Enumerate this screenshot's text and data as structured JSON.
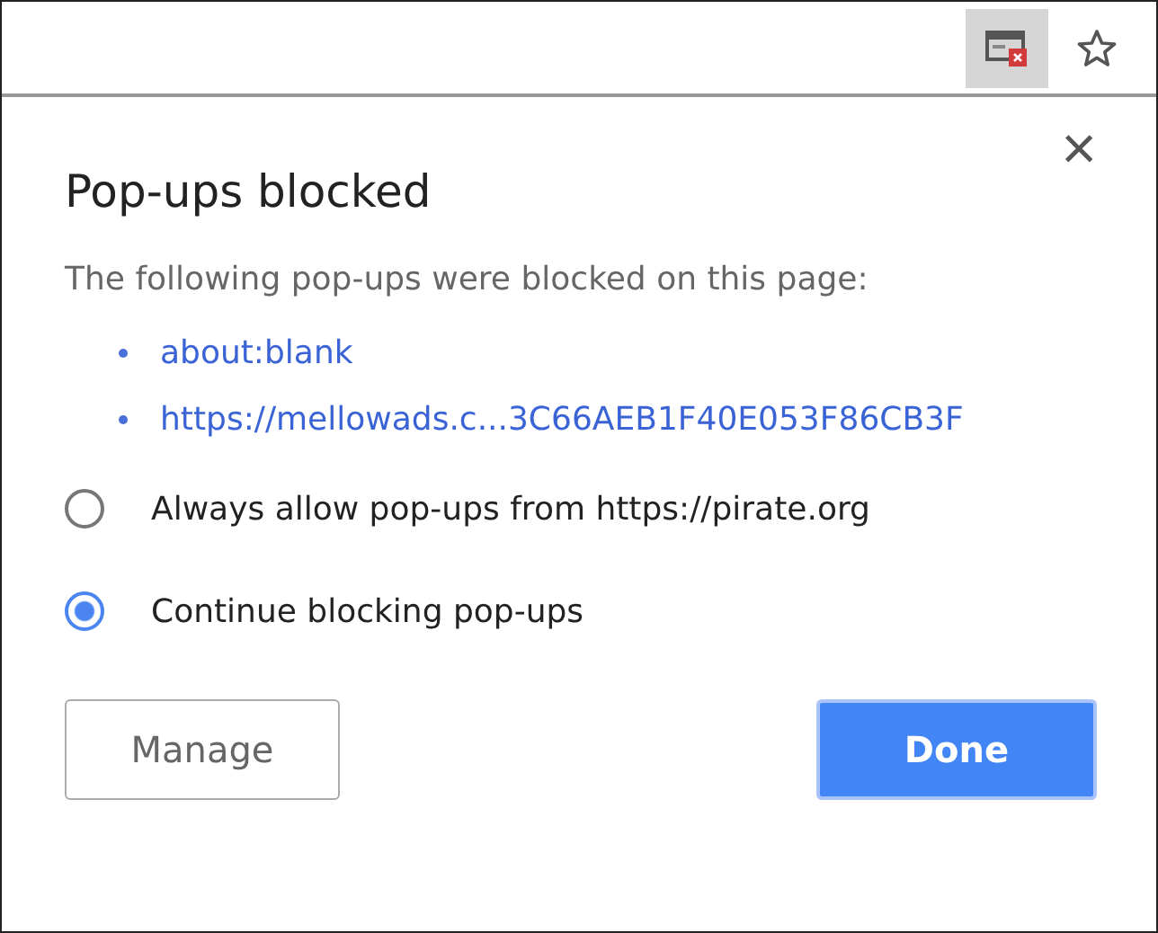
{
  "toolbar": {
    "popup_blocked_pressed": true
  },
  "dialog": {
    "title": "Pop-ups blocked",
    "close": "×",
    "description": "The following pop-ups were blocked on this page:",
    "links": [
      "about:blank",
      "https://mellowads.c...3C66AEB1F40E053F86CB3F"
    ],
    "options": [
      {
        "label": "Always allow pop-ups from https://pirate.org",
        "selected": false
      },
      {
        "label": "Continue blocking pop-ups",
        "selected": true
      }
    ],
    "buttons": [
      {
        "label": "Manage",
        "kind": "secondary"
      },
      {
        "label": "Done",
        "kind": "primary"
      }
    ]
  }
}
